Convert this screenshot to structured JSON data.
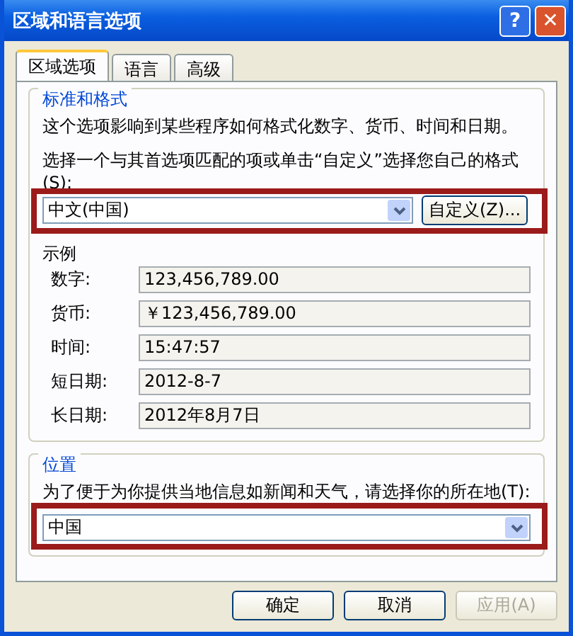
{
  "window": {
    "title": "区域和语言选项"
  },
  "title_buttons": [
    {
      "label": "?",
      "kind": "help"
    },
    {
      "label": "✕",
      "kind": "close"
    }
  ],
  "tabs": [
    {
      "label": "区域选项",
      "selected": true
    },
    {
      "label": "语言",
      "selected": false
    },
    {
      "label": "高级",
      "selected": false
    }
  ],
  "format_group": {
    "title": "标准和格式",
    "description": "这个选项影响到某些程序如何格式化数字、货币、时间和日期。",
    "instruction": "选择一个与其首选项匹配的项或单击“自定义”选择您自己的格式(S):",
    "value": "中文(中国)",
    "customize_button": "自定义(Z)...",
    "highlighted": true
  },
  "samples": {
    "title": "示例",
    "rows": [
      {
        "label": "数字:",
        "value": "123,456,789.00"
      },
      {
        "label": "货币:",
        "value": "￥123,456,789.00"
      },
      {
        "label": "时间:",
        "value": "15:47:57"
      },
      {
        "label": "短日期:",
        "value": "2012-8-7"
      },
      {
        "label": "长日期:",
        "value": "2012年8月7日"
      }
    ]
  },
  "location_group": {
    "title": "位置",
    "description": "为了便于为你提供当地信息如新闻和天气，请选择你的所在地(T):",
    "value": "中国",
    "highlighted": true
  },
  "buttons": [
    {
      "label": "确定",
      "disabled": false
    },
    {
      "label": "取消",
      "disabled": false
    },
    {
      "label": "应用(A)",
      "disabled": true
    }
  ]
}
